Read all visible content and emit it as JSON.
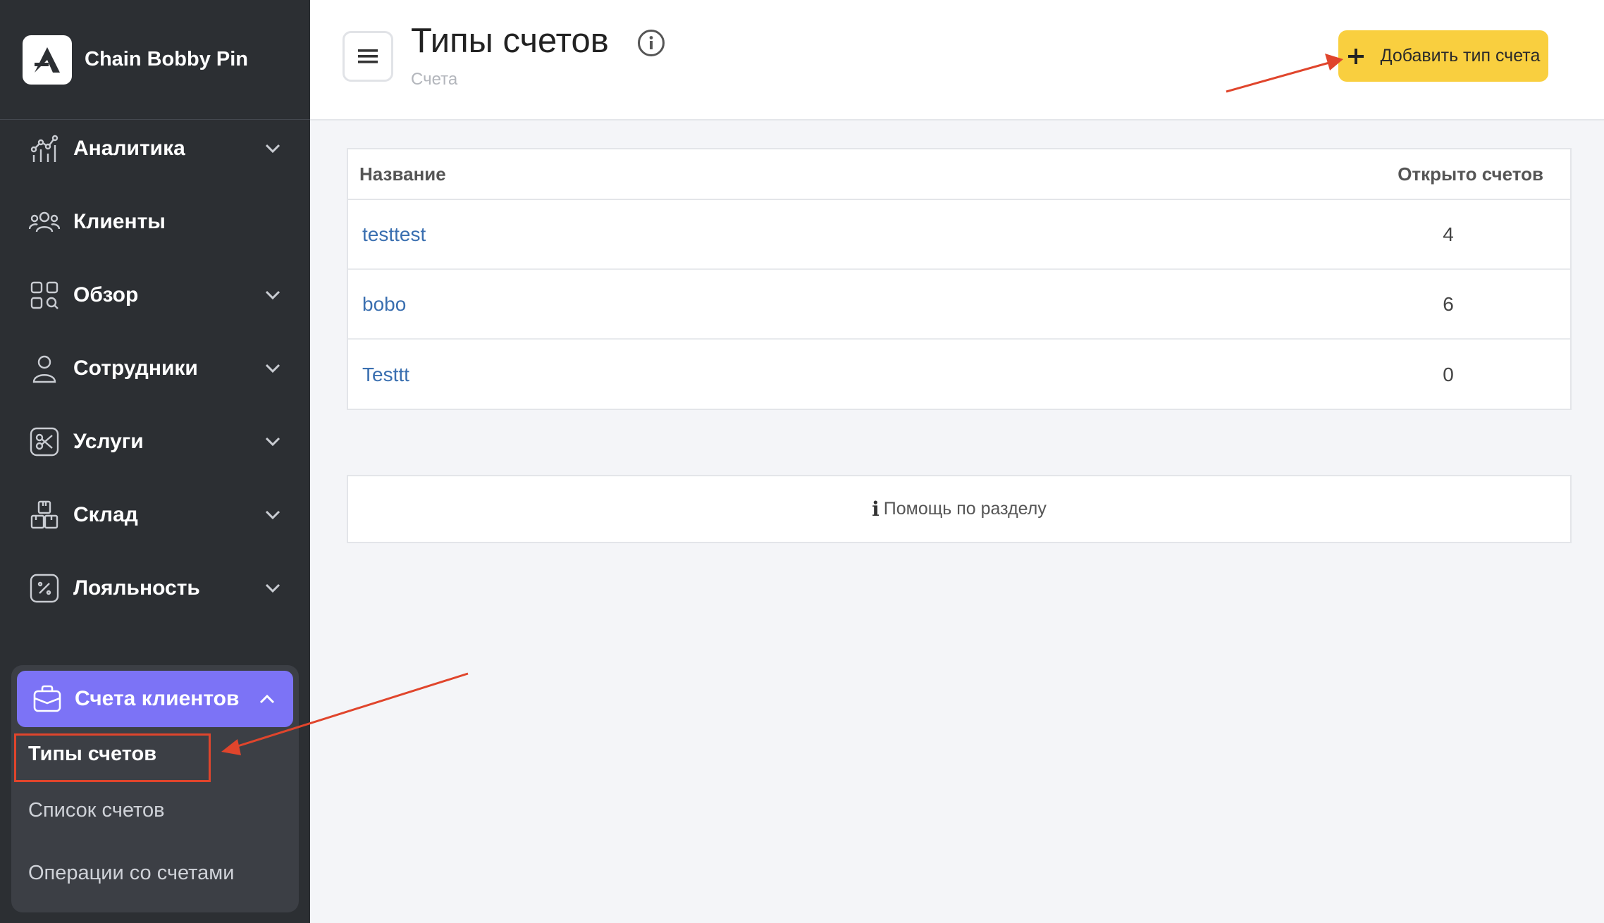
{
  "brand": {
    "name": "Chain Bobby Pin"
  },
  "sidebar": {
    "items": [
      {
        "label": "Аналитика",
        "icon": "analytics-icon",
        "expandable": true
      },
      {
        "label": "Клиенты",
        "icon": "clients-icon",
        "expandable": false
      },
      {
        "label": "Обзор",
        "icon": "overview-icon",
        "expandable": true
      },
      {
        "label": "Сотрудники",
        "icon": "staff-icon",
        "expandable": true
      },
      {
        "label": "Услуги",
        "icon": "scissors-icon",
        "expandable": true
      },
      {
        "label": "Склад",
        "icon": "warehouse-icon",
        "expandable": true
      },
      {
        "label": "Лояльность",
        "icon": "percent-icon",
        "expandable": true
      }
    ],
    "active_group": {
      "label": "Счета клиентов",
      "icon": "briefcase-icon",
      "sub_items": [
        {
          "label": "Типы счетов",
          "active": true
        },
        {
          "label": "Список счетов",
          "active": false
        },
        {
          "label": "Операции со счетами",
          "active": false
        }
      ]
    }
  },
  "header": {
    "title": "Типы счетов",
    "subtitle": "Счета",
    "add_button": "Добавить тип счета"
  },
  "table": {
    "columns": [
      "Название",
      "Открыто счетов"
    ],
    "rows": [
      {
        "name": "testtest",
        "count": "4"
      },
      {
        "name": "bobo",
        "count": "6"
      },
      {
        "name": "Testtt",
        "count": "0"
      }
    ]
  },
  "help": {
    "label": "Помощь по разделу"
  },
  "colors": {
    "sidebar_bg": "#2c2f33",
    "accent": "#7c73f6",
    "add_button": "#f9cf3f",
    "link": "#3a6fb0",
    "annotation": "#e0452c"
  }
}
